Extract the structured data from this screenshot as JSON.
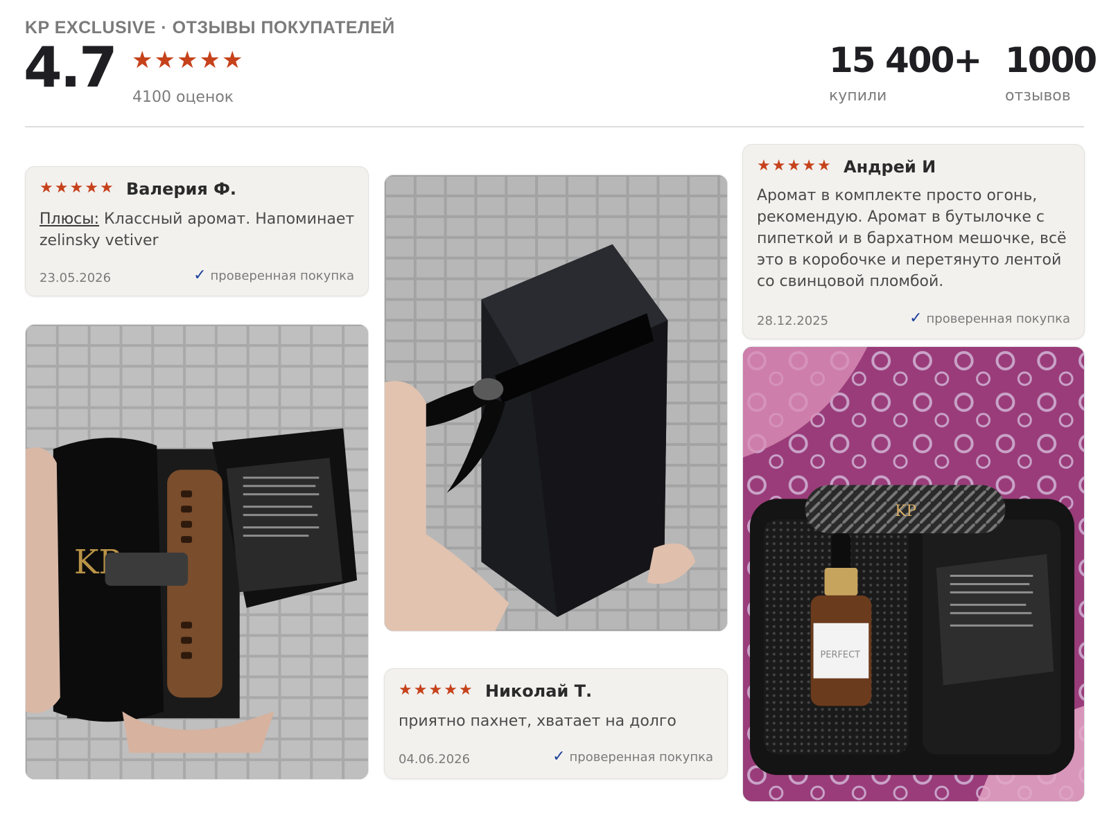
{
  "header": {
    "kicker": "KP EXCLUSIVE · ОТЗЫВЫ ПОКУПАТЕЛЕЙ",
    "rating": "4.7",
    "stars": 5,
    "ratings_count": "4100 оценок",
    "stats": [
      {
        "value": "15 400+",
        "label": "купили"
      },
      {
        "value": "1000",
        "label": "отзывов"
      }
    ]
  },
  "reviews": [
    {
      "stars": 5,
      "author": "Валерия Ф.",
      "plus_label": "Плюсы:",
      "text": " Классный аромат. Напоминает zelinsky vetiver",
      "date": "23.05.2026",
      "verified": "проверенная покупка"
    },
    {
      "stars": 5,
      "author": "Андрей И",
      "text": "Аромат в комплекте просто огонь, рекомендую. Аромат в бутылочке с пипеткой и в бархатном мешочке, всё это в коробочке и перетянуто лентой со свинцовой пломбой.",
      "date": "28.12.2025",
      "verified": "проверенная покупка"
    },
    {
      "stars": 5,
      "author": "Николай Т.",
      "text": "приятно пахнет, хватает на долго",
      "date": "04.06.2026",
      "verified": "проверенная покупка"
    }
  ],
  "photos": {
    "pouch_box": {
      "logo": "KP"
    },
    "gift_box": {},
    "travel_case": {
      "logo": "KP",
      "bottle_label": "PERFECT"
    }
  },
  "colors": {
    "star": "#c6421b",
    "check": "#1d3f9a",
    "card_bg": "#f2f1ee"
  },
  "icons": {
    "star": "star-icon",
    "check": "check-icon"
  }
}
